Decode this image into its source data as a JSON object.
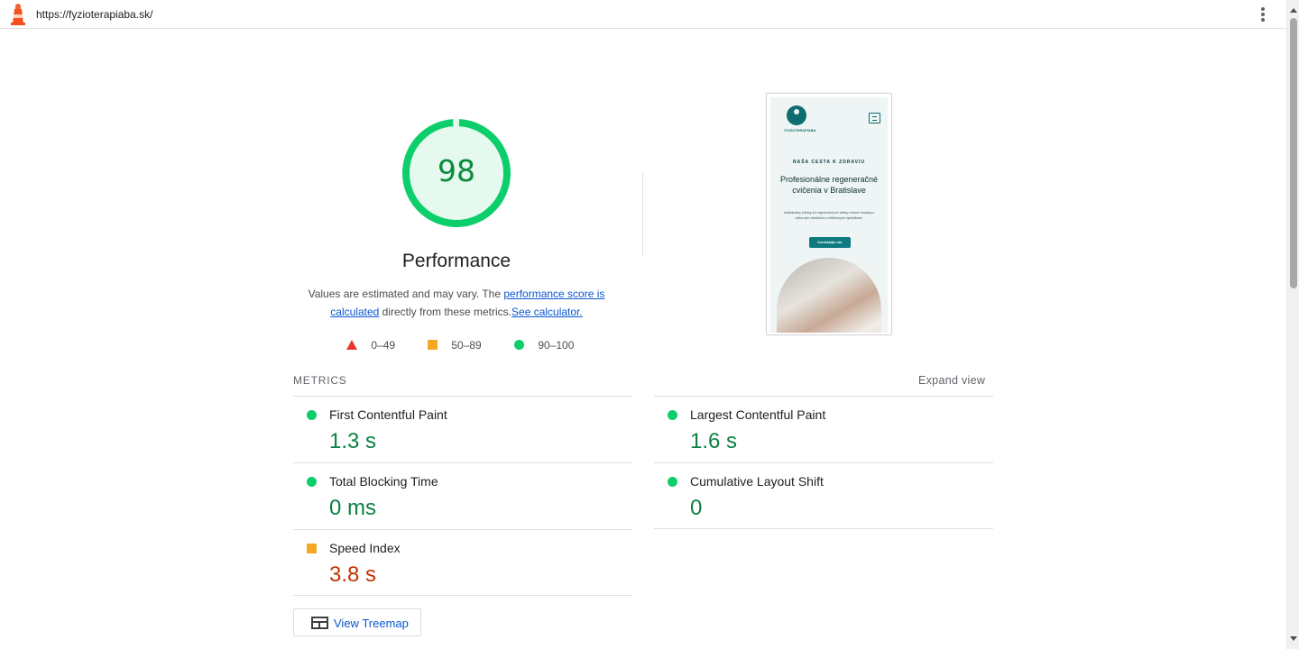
{
  "topbar": {
    "url": "https://fyzioterapiaba.sk/",
    "logo_icon": "lighthouse-icon",
    "menu_icon": "more-vert-icon"
  },
  "gauge": {
    "score": 98,
    "score_text": "98",
    "title": "Performance",
    "color": "#0cce6b"
  },
  "description": {
    "prefix": "Values are estimated and may vary. The ",
    "link1": "performance score is calculated",
    "middle": " directly from these metrics.",
    "link2": "See calculator."
  },
  "legend": [
    {
      "range": "0–49",
      "icon": "red-triangle-icon",
      "color": "#e8382e"
    },
    {
      "range": "50–89",
      "icon": "orange-square-icon",
      "color": "#f5a623"
    },
    {
      "range": "90–100",
      "icon": "green-circle-icon",
      "color": "#0cce6b"
    }
  ],
  "screenshot": {
    "brand": "FYZIOTERAPIABA",
    "eyebrow": "NAŠA CESTA K ZDRAVIU",
    "headline": "Profesionálne regeneračné cvičenia v Bratislave",
    "body": "Individuálny prístup ku regenerácii pre všetky vekové skupiny s odborným dohľadom a efektívnymi výsledkami.",
    "cta": "Kontaktujte nás"
  },
  "metrics": {
    "header": "METRICS",
    "expand_label": "Expand view",
    "items": [
      {
        "label": "First Contentful Paint",
        "value": "1.3 s",
        "status": "pass"
      },
      {
        "label": "Largest Contentful Paint",
        "value": "1.6 s",
        "status": "pass"
      },
      {
        "label": "Total Blocking Time",
        "value": "0 ms",
        "status": "pass"
      },
      {
        "label": "Cumulative Layout Shift",
        "value": "0",
        "status": "pass"
      },
      {
        "label": "Speed Index",
        "value": "3.8 s",
        "status": "average"
      }
    ]
  },
  "treemap": {
    "label": "View Treemap",
    "icon": "treemap-icon"
  }
}
